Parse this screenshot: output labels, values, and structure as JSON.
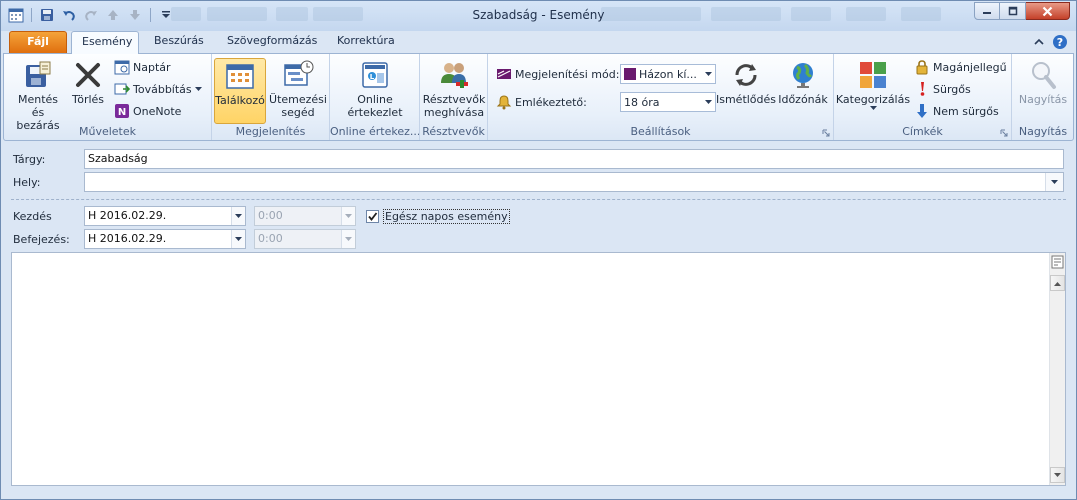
{
  "window": {
    "title": "Szabadság - Esemény"
  },
  "tabs": [
    {
      "label": "Fájl"
    },
    {
      "label": "Esemény"
    },
    {
      "label": "Beszúrás"
    },
    {
      "label": "Szövegformázás"
    },
    {
      "label": "Korrektúra"
    }
  ],
  "ribbon": {
    "muveletek": {
      "label": "Műveletek",
      "save_close": "Mentés és bezárás",
      "save_line1": "Mentés és",
      "save_line2": "bezárás",
      "delete": "Törlés",
      "calendar": "Naptár",
      "forward": "Továbbítás",
      "onenote": "OneNote"
    },
    "megjelenites": {
      "label": "Megjelenítés",
      "appointment": "Találkozó",
      "scheduling_line1": "Ütemezési",
      "scheduling_line2": "segéd"
    },
    "online": {
      "label": "Online értekez...",
      "meeting_line1": "Online",
      "meeting_line2": "értekezlet"
    },
    "resztvevok": {
      "label": "Résztvevők",
      "invite_line1": "Résztvevők",
      "invite_line2": "meghívása"
    },
    "beallitasok": {
      "label": "Beállítások",
      "show_as_label": "Megjelenítési mód:",
      "show_as_value": "Házon kí...",
      "show_as_color": "#6a1a6e",
      "reminder_label": "Emlékeztető:",
      "reminder_value": "18 óra",
      "recurrence": "Ismétlődés",
      "timezones": "Időzónák"
    },
    "cimkek": {
      "label": "Címkék",
      "categorize": "Kategorizálás",
      "private": "Magánjellegű",
      "high": "Sürgős",
      "low": "Nem sürgős"
    },
    "nagyitas": {
      "label": "Nagyítás",
      "zoom": "Nagyítás"
    }
  },
  "form": {
    "subject_label": "Tárgy:",
    "subject_value": "Szabadság",
    "location_label": "Hely:",
    "location_value": "",
    "start_label": "Kezdés",
    "start_date": "H 2016.02.29.",
    "start_time": "0:00",
    "end_label": "Befejezés:",
    "end_date": "H 2016.02.29.",
    "end_time": "0:00",
    "allday_label": "Egész napos esemény",
    "allday_checked": true
  }
}
